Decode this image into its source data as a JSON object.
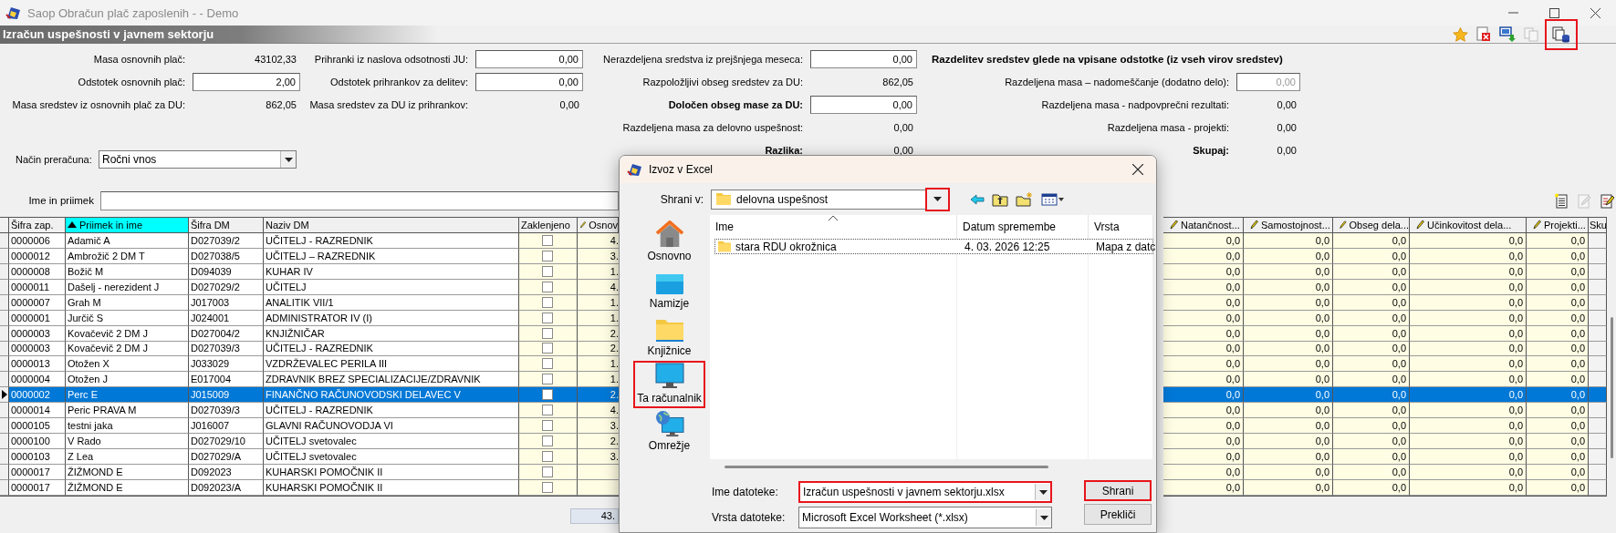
{
  "window": {
    "title": "Saop Obračun plač zaposlenih -  - Demo"
  },
  "module": {
    "title": "Izračun uspešnosti v javnem sektorju",
    "toolbar": [
      {
        "kind": "favorite",
        "disabled": false,
        "highlighted": false
      },
      {
        "kind": "delete",
        "disabled": false,
        "highlighted": false
      },
      {
        "kind": "export",
        "disabled": false,
        "highlighted": false
      },
      {
        "kind": "copy",
        "disabled": true,
        "highlighted": false
      },
      {
        "kind": "excel",
        "disabled": false,
        "highlighted": true
      }
    ]
  },
  "form": {
    "columns": [
      [
        {
          "label": "Masa osnovnih plač:",
          "value": "43102,33",
          "kind": "readout",
          "emphasis": false
        },
        {
          "label": "Odstotek osnovnih plač:",
          "value": "2,00",
          "kind": "input",
          "emphasis": false
        },
        {
          "label": "Masa sredstev iz osnovnih plač za DU:",
          "value": "862,05",
          "kind": "readout",
          "emphasis": false
        }
      ],
      [
        {
          "label": "Prihranki iz naslova odsotnosti JU:",
          "value": "0,00",
          "kind": "input",
          "emphasis": false
        },
        {
          "label": "Odstotek prihrankov za delitev:",
          "value": "0,00",
          "kind": "input",
          "emphasis": false
        },
        {
          "label": "Masa sredstev za DU iz prihrankov:",
          "value": "0,00",
          "kind": "readout",
          "emphasis": false
        }
      ],
      [
        {
          "label": "Nerazdeljena sredstva iz prejšnjega meseca:",
          "value": "0,00",
          "kind": "input",
          "emphasis": false
        },
        {
          "label": "Razpoložljivi obseg sredstev za DU:",
          "value": "862,05",
          "kind": "readout",
          "emphasis": false
        },
        {
          "label": "Določen obseg mase za DU:",
          "value": "0,00",
          "kind": "input",
          "emphasis": true
        },
        {
          "label": "Razdeljena masa za delovno uspešnost:",
          "value": "0,00",
          "kind": "readout",
          "emphasis": false
        },
        {
          "label": "Razlika:",
          "value": "0,00",
          "kind": "readout",
          "emphasis": true
        }
      ],
      [
        {
          "label": "Razdelitev sredstev glede na vpisane odstotke (iz vseh virov sredstev)",
          "kind": "heading",
          "emphasis": true
        },
        {
          "label": "Razdeljena masa – nadomeščanje (dodatno delo):",
          "value": "0,00",
          "kind": "locked-input",
          "emphasis": false
        },
        {
          "label": "Razdeljena masa - nadpovprečni rezultati:",
          "value": "0,00",
          "kind": "readout",
          "emphasis": false
        },
        {
          "label": "Razdeljena masa - projekti:",
          "value": "0,00",
          "kind": "readout",
          "emphasis": false
        },
        {
          "label": "Skupaj:",
          "value": "0,00",
          "kind": "readout",
          "emphasis": true
        }
      ]
    ],
    "method": {
      "label": "Način preračuna:",
      "value": "Ročni vnos"
    }
  },
  "search": {
    "label": "Ime in priimek"
  },
  "grid_toolbar": [
    {
      "kind": "new",
      "disabled": false
    },
    {
      "kind": "edit",
      "disabled": true
    },
    {
      "kind": "edit-all",
      "disabled": false
    }
  ],
  "table": {
    "columns_left": [
      {
        "label": "Šifra zap.",
        "sorted": false,
        "editable": false
      },
      {
        "label": "Priimek in ime",
        "sorted": true,
        "editable": false
      },
      {
        "label": "Šifra DM",
        "sorted": false,
        "editable": false
      },
      {
        "label": "Naziv DM",
        "sorted": false,
        "editable": false
      },
      {
        "label": "Zaklenjeno",
        "sorted": false,
        "editable": false
      },
      {
        "label": "Osnov",
        "sorted": false,
        "editable": true
      }
    ],
    "columns_right": [
      {
        "label": "Natančnost...",
        "sorted": false,
        "editable": true
      },
      {
        "label": "Samostojnost...",
        "sorted": false,
        "editable": true
      },
      {
        "label": "Obseg dela...",
        "sorted": false,
        "editable": true
      },
      {
        "label": "Učinkovitost dela...",
        "sorted": false,
        "editable": true
      },
      {
        "label": "Projekti...",
        "sorted": false,
        "editable": true
      },
      {
        "label": "Sku",
        "sorted": false,
        "editable": false
      }
    ],
    "rows": [
      {
        "cells": [
          "0000006",
          "Adamič A",
          "D027039/2",
          "UČITELJ - RAZREDNIK"
        ],
        "locked": false,
        "osnova": "4.",
        "values": [
          "0,0",
          "0,0",
          "0,0",
          "0,0",
          "0,0"
        ],
        "selected": false
      },
      {
        "cells": [
          "0000012",
          "Ambrožič 2 DM  T",
          "D027038/5",
          "UČITELJ – RAZREDNIK"
        ],
        "locked": false,
        "osnova": "3.",
        "values": [
          "0,0",
          "0,0",
          "0,0",
          "0,0",
          "0,0"
        ],
        "selected": false
      },
      {
        "cells": [
          "0000008",
          "Božič M",
          "D094039",
          "KUHAR IV"
        ],
        "locked": false,
        "osnova": "1.",
        "values": [
          "0,0",
          "0,0",
          "0,0",
          "0,0",
          "0,0"
        ],
        "selected": false
      },
      {
        "cells": [
          "0000011",
          "Dašelj - nerezident J",
          "D027029/2",
          "UČITELJ"
        ],
        "locked": false,
        "osnova": "4.",
        "values": [
          "0,0",
          "0,0",
          "0,0",
          "0,0",
          "0,0"
        ],
        "selected": false
      },
      {
        "cells": [
          "0000007",
          "Grah M",
          "J017003",
          "ANALITIK VII/1"
        ],
        "locked": false,
        "osnova": "1.",
        "values": [
          "0,0",
          "0,0",
          "0,0",
          "0,0",
          "0,0"
        ],
        "selected": false
      },
      {
        "cells": [
          "0000001",
          "Jurčič S",
          "J024001",
          "ADMINISTRATOR IV (I)"
        ],
        "locked": false,
        "osnova": "1.",
        "values": [
          "0,0",
          "0,0",
          "0,0",
          "0,0",
          "0,0"
        ],
        "selected": false
      },
      {
        "cells": [
          "0000003",
          "Kovačevič 2 DM J",
          "D027004/2",
          "KNJIŽNIČAR"
        ],
        "locked": false,
        "osnova": "2.",
        "values": [
          "0,0",
          "0,0",
          "0,0",
          "0,0",
          "0,0"
        ],
        "selected": false
      },
      {
        "cells": [
          "0000003",
          "Kovačevič 2 DM J",
          "D027039/3",
          "UČITELJ - RAZREDNIK"
        ],
        "locked": false,
        "osnova": "2.",
        "values": [
          "0,0",
          "0,0",
          "0,0",
          "0,0",
          "0,0"
        ],
        "selected": false
      },
      {
        "cells": [
          "0000013",
          "Otožen  X",
          "J033029",
          "VZDRŽEVALEC PERILA III"
        ],
        "locked": false,
        "osnova": "1.",
        "values": [
          "0,0",
          "0,0",
          "0,0",
          "0,0",
          "0,0"
        ],
        "selected": false
      },
      {
        "cells": [
          "0000004",
          "Otožen J",
          "E017004",
          "ZDRAVNIK BREZ SPECIALIZACIJE/ZDRAVNIK"
        ],
        "locked": false,
        "osnova": "1.",
        "values": [
          "0,0",
          "0,0",
          "0,0",
          "0,0",
          "0,0"
        ],
        "selected": false
      },
      {
        "cells": [
          "0000002",
          "Perc E",
          "J015009",
          "FINANČNO RAČUNOVODSKI DELAVEC V"
        ],
        "locked": false,
        "osnova": "2.",
        "values": [
          "0,0",
          "0,0",
          "0,0",
          "0,0",
          "0,0"
        ],
        "selected": true
      },
      {
        "cells": [
          "0000014",
          "Peric  PRAVA M",
          "D027039/3",
          "UČITELJ - RAZREDNIK"
        ],
        "locked": false,
        "osnova": "4.",
        "values": [
          "0,0",
          "0,0",
          "0,0",
          "0,0",
          "0,0"
        ],
        "selected": false
      },
      {
        "cells": [
          "0000105",
          "testni jaka",
          "J016007",
          "GLAVNI RAČUNOVODJA VI"
        ],
        "locked": false,
        "osnova": "3.",
        "values": [
          "0,0",
          "0,0",
          "0,0",
          "0,0",
          "0,0"
        ],
        "selected": false
      },
      {
        "cells": [
          "0000100",
          "V Rado",
          "D027029/10",
          "UČITELJ svetovalec"
        ],
        "locked": false,
        "osnova": "2.",
        "values": [
          "0,0",
          "0,0",
          "0,0",
          "0,0",
          "0,0"
        ],
        "selected": false
      },
      {
        "cells": [
          "0000103",
          "Z Lea",
          "D027029/A",
          "UČITELJ svetovalec"
        ],
        "locked": false,
        "osnova": "3.",
        "values": [
          "0,0",
          "0,0",
          "0,0",
          "0,0",
          "0,0"
        ],
        "selected": false
      },
      {
        "cells": [
          "0000017",
          "ŽIŽMOND E",
          "D092023",
          "KUHARSKI POMOČNIK II"
        ],
        "locked": false,
        "values": [
          "0,0",
          "0,0",
          "0,0",
          "0,0",
          "0,0"
        ],
        "selected": false
      },
      {
        "cells": [
          "0000017",
          "ŽIŽMOND E",
          "D092023/A",
          "KUHARSKI POMOČNIK II"
        ],
        "locked": false,
        "values": [
          "0,0",
          "0,0",
          "0,0",
          "0,0",
          "0,0"
        ],
        "selected": false
      }
    ],
    "total": "43."
  },
  "dialog": {
    "title": "Izvoz v Excel",
    "save_in": {
      "label": "Shrani v:",
      "value": "delovna uspešnost",
      "highlighted": true
    },
    "tools": [
      {
        "kind": "back"
      },
      {
        "kind": "up"
      },
      {
        "kind": "new-folder"
      },
      {
        "kind": "views"
      }
    ],
    "places": [
      {
        "label": "Osnovno",
        "kind": "home",
        "highlighted": false
      },
      {
        "label": "Namizje",
        "kind": "desktop",
        "highlighted": false
      },
      {
        "label": "Knjižnice",
        "kind": "libraries",
        "highlighted": false
      },
      {
        "label": "Ta računalnik",
        "kind": "computer",
        "highlighted": true
      },
      {
        "label": "Omrežje",
        "kind": "network",
        "highlighted": false
      }
    ],
    "files": {
      "columns": [
        "Ime",
        "Datum spremembe",
        "Vrsta"
      ],
      "rows": [
        {
          "name": "stara RDU okrožnica",
          "date": "4. 03. 2026 12:25",
          "type": "Mapa z datc",
          "kind": "folder"
        }
      ]
    },
    "file_name": {
      "label": "Ime datoteke:",
      "value": "Izračun uspešnosti v javnem sektorju.xlsx",
      "highlighted": true
    },
    "file_type": {
      "label": "Vrsta datoteke:",
      "value": "Microsoft Excel Worksheet (*.xlsx)"
    },
    "buttons": [
      {
        "label": "Shrani",
        "highlighted": true
      },
      {
        "label": "Prekliči",
        "highlighted": false
      }
    ]
  }
}
